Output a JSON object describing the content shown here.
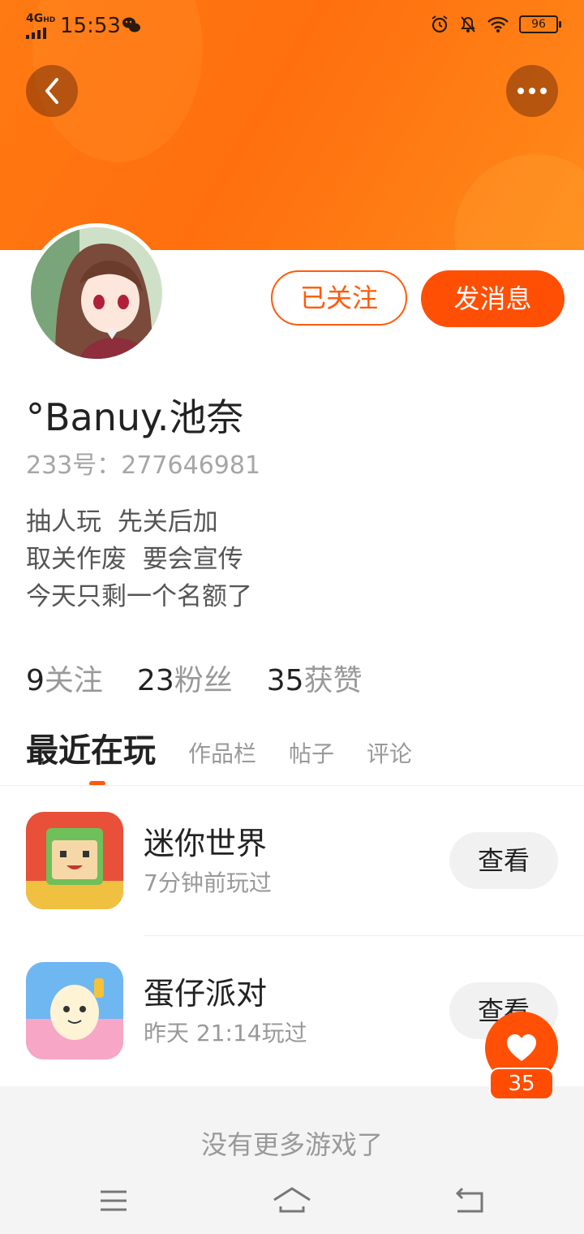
{
  "status_bar": {
    "network": "4G",
    "network_sub": "HD",
    "time": "15:53",
    "battery": "96"
  },
  "header": {
    "back_icon": "chevron-left-icon",
    "more_icon": "more-dots-icon"
  },
  "profile": {
    "follow_button_label": "已关注",
    "message_button_label": "发消息",
    "username": "°Banuy.池奈",
    "user_id_label": "233号：277646981",
    "bio_lines": [
      "抽人玩  先关后加",
      "取关作废  要会宣传",
      "今天只剩一个名额了"
    ]
  },
  "stats": [
    {
      "num": "9",
      "label": "关注"
    },
    {
      "num": "23",
      "label": "粉丝"
    },
    {
      "num": "35",
      "label": "获赞"
    }
  ],
  "tabs": {
    "active": "最近在玩",
    "items": [
      "作品栏",
      "帖子",
      "评论"
    ]
  },
  "games": [
    {
      "name": "迷你世界",
      "time": "7分钟前玩过",
      "button": "查看"
    },
    {
      "name": "蛋仔派对",
      "time": "昨天 21:14玩过",
      "button": "查看"
    }
  ],
  "footer": {
    "no_more_text": "没有更多游戏了"
  },
  "like": {
    "count": "35",
    "icon": "heart-icon"
  },
  "colors": {
    "accent": "#ff5a0a",
    "header": "#ff7a12"
  }
}
